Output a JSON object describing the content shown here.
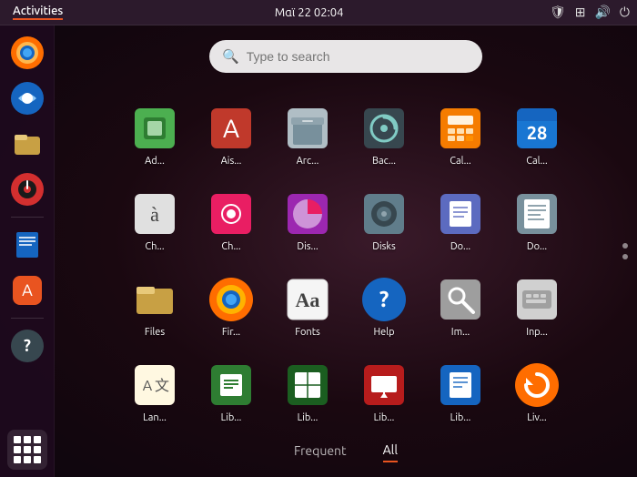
{
  "topbar": {
    "activities": "Activities",
    "datetime": "Μαϊ 22  02:04"
  },
  "search": {
    "placeholder": "Type to search"
  },
  "tabs": [
    {
      "id": "frequent",
      "label": "Frequent",
      "active": false
    },
    {
      "id": "all",
      "label": "All",
      "active": true
    }
  ],
  "apps": [
    {
      "id": "cpu",
      "label": "Ad...",
      "icon_class": "icon-cpu",
      "symbol": "🔲"
    },
    {
      "id": "aisleriot",
      "label": "Ais...",
      "icon_class": "icon-aisleriot",
      "symbol": "♠"
    },
    {
      "id": "archive",
      "label": "Arc...",
      "icon_class": "icon-archive",
      "symbol": "📦"
    },
    {
      "id": "backup",
      "label": "Bac...",
      "icon_class": "icon-backup",
      "symbol": "💾"
    },
    {
      "id": "calc",
      "label": "Cal...",
      "icon_class": "icon-calc",
      "symbol": "🖩"
    },
    {
      "id": "calendar",
      "label": "Cal...",
      "icon_class": "icon-calendar",
      "symbol": "📅"
    },
    {
      "id": "charmap",
      "label": "Ch...",
      "icon_class": "icon-charmap",
      "symbol": "à"
    },
    {
      "id": "chrome",
      "label": "Ch...",
      "icon_class": "icon-chrome",
      "symbol": "◎"
    },
    {
      "id": "diskusage",
      "label": "Dis...",
      "icon_class": "icon-disk-usage",
      "symbol": "◑"
    },
    {
      "id": "disks",
      "label": "Disks",
      "icon_class": "icon-disks",
      "symbol": "💿"
    },
    {
      "id": "doc",
      "label": "Do...",
      "icon_class": "icon-doc",
      "symbol": "📄"
    },
    {
      "id": "docviewer",
      "label": "Do...",
      "icon_class": "icon-docviewer",
      "symbol": "📖"
    },
    {
      "id": "files2",
      "label": "Files",
      "icon_class": "icon-files2",
      "symbol": "🗂"
    },
    {
      "id": "firefox",
      "label": "Fir...",
      "icon_class": "icon-firefox",
      "symbol": "🔥"
    },
    {
      "id": "fonts",
      "label": "Fonts",
      "icon_class": "icon-fonts",
      "symbol": "Aa"
    },
    {
      "id": "help",
      "label": "Help",
      "icon_class": "icon-help",
      "symbol": "?"
    },
    {
      "id": "image",
      "label": "Im...",
      "icon_class": "icon-image",
      "symbol": "🔍"
    },
    {
      "id": "input",
      "label": "Inp...",
      "icon_class": "icon-input",
      "symbol": "⌨"
    },
    {
      "id": "lang",
      "label": "Lan...",
      "icon_class": "icon-lang",
      "symbol": "A文"
    },
    {
      "id": "libreoffice",
      "label": "Lib...",
      "icon_class": "icon-libreoffice",
      "symbol": "📊"
    },
    {
      "id": "librecalc",
      "label": "Lib...",
      "icon_class": "icon-librecalc",
      "symbol": "📊"
    },
    {
      "id": "libreimpress",
      "label": "Lib...",
      "icon_class": "icon-libreimpress",
      "symbol": "📊"
    },
    {
      "id": "librewriter",
      "label": "Lib...",
      "icon_class": "icon-librewriter",
      "symbol": "📝"
    },
    {
      "id": "livepatch",
      "label": "Liv...",
      "icon_class": "icon-livepatch",
      "symbol": "🔄"
    }
  ],
  "sidebar_icons": [
    {
      "id": "firefox",
      "symbol": "🦊",
      "label": "Firefox"
    },
    {
      "id": "thunderbird",
      "symbol": "✉",
      "label": "Thunderbird"
    },
    {
      "id": "files",
      "symbol": "📁",
      "label": "Files"
    },
    {
      "id": "rhythmbox",
      "symbol": "🎵",
      "label": "Rhythmbox"
    },
    {
      "id": "writer",
      "symbol": "📝",
      "label": "Writer"
    },
    {
      "id": "software",
      "symbol": "🏪",
      "label": "Software"
    },
    {
      "id": "help",
      "symbol": "❓",
      "label": "Help"
    }
  ],
  "colors": {
    "accent": "#e95420",
    "topbar_bg": "#2c1a2c",
    "sidebar_bg": "#1e0a1e"
  }
}
